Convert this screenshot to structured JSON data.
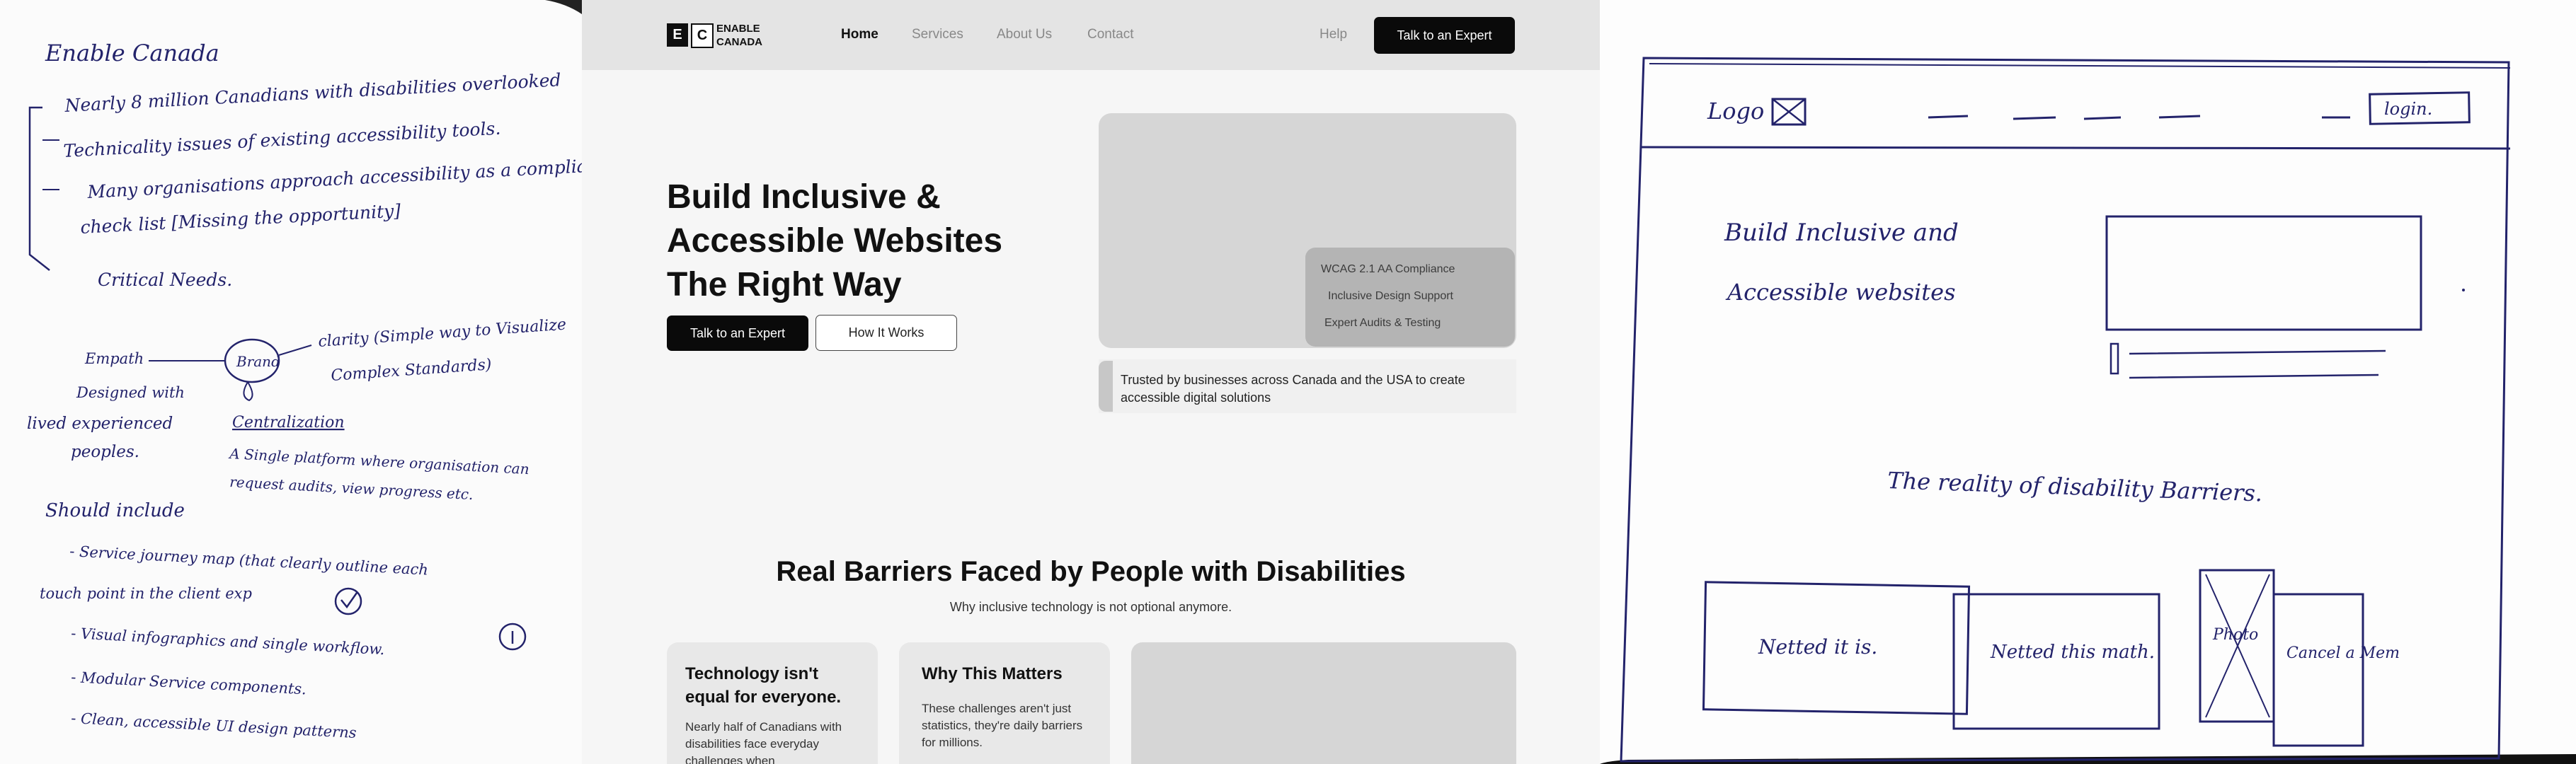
{
  "notes": {
    "title": "Enable Canada",
    "lines": [
      "Nearly 8 million Canadians with disabilities overlooked",
      "Technicality issues of existing accessibility tools.",
      "Many organisations approach accessibility as a compliance",
      "check list [Missing the opportunity]",
      "Critical Needs."
    ],
    "mindmap": {
      "center": "Brand",
      "left_top": "Empath",
      "left_mid": "Designed with",
      "left_b1": "lived experienced",
      "left_b2": "peoples.",
      "right_top": "clarity (Simple way to Visualize",
      "right_top2": "Complex Standards)",
      "right_mid": "Centralization",
      "right_b1": "A Single platform where organisation can",
      "right_b2": "request audits, view progress etc."
    },
    "should_title": "Should include",
    "should_items": [
      "- Service journey map (that clearly outline each",
      "touch point in the client exp",
      "- Visual infographics and single workflow.",
      "- Modular Service components.",
      "- Clean, accessible UI design patterns"
    ]
  },
  "site": {
    "logo_letters": [
      "E",
      "C"
    ],
    "logo_line1": "ENABLE",
    "logo_line2": "CANADA",
    "nav": [
      "Home",
      "Services",
      "About Us",
      "Contact"
    ],
    "help": "Help",
    "cta": "Talk to an Expert",
    "hero_title": "Build Inclusive & Accessible Websites The Right Way",
    "hero_primary": "Talk to an Expert",
    "hero_secondary": "How It Works",
    "features": [
      "WCAG 2.1 AA Compliance",
      "Inclusive Design Support",
      "Expert Audits & Testing"
    ],
    "trust": "Trusted by businesses across Canada and the USA to create accessible digital solutions",
    "section_title": "Real Barriers Faced by People with Disabilities",
    "section_subtitle": "Why inclusive technology is not optional anymore.",
    "card1_title": "Technology isn't equal for everyone.",
    "card1_body": "Nearly half of Canadians with disabilities face everyday challenges when",
    "card2_title": "Why This Matters",
    "card2_body": "These challenges aren't just statistics, they're daily barriers for millions."
  },
  "wireframe": {
    "logo": "Logo",
    "login": "login.",
    "hero_line1": "Build Inclusive and",
    "hero_line2": "Accessible websites",
    "section": "The reality of disability Barriers.",
    "card1": "Netted it is.",
    "card2": "Netted this math.",
    "photo": "Photo",
    "card4": "Cancel a Mem"
  },
  "colors": {
    "ink": "#23236b",
    "dark": "#0a0a0a",
    "nav_bg": "#e4e4e4",
    "page_bg": "#f6f6f6"
  }
}
